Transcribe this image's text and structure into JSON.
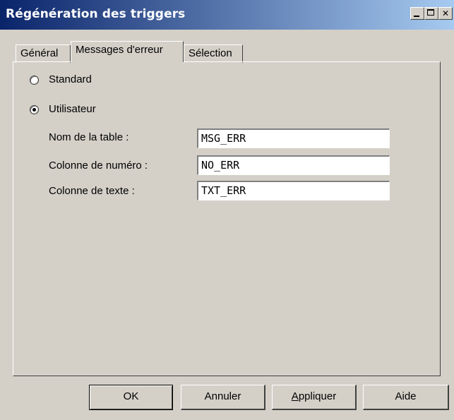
{
  "window": {
    "title": "Régénération des triggers",
    "title_bar_colors": [
      "#0a246a",
      "#a6caf0"
    ]
  },
  "tabs": [
    {
      "label": "Général",
      "active": false
    },
    {
      "label": "Messages d'erreur",
      "active": true
    },
    {
      "label": "Sélection",
      "active": false
    }
  ],
  "options": {
    "standard_label": "Standard",
    "user_label": "Utilisateur",
    "selected": "Utilisateur"
  },
  "fields": {
    "table_name": {
      "label": "Nom de la table :",
      "value": "MSG_ERR"
    },
    "number_column": {
      "label": "Colonne de numéro :",
      "value": "NO_ERR"
    },
    "text_column": {
      "label": "Colonne de texte :",
      "value": "TXT_ERR"
    }
  },
  "buttons": {
    "ok": "OK",
    "cancel": "Annuler",
    "apply_accel": "A",
    "apply_rest": "ppliquer",
    "help": "Aide"
  }
}
